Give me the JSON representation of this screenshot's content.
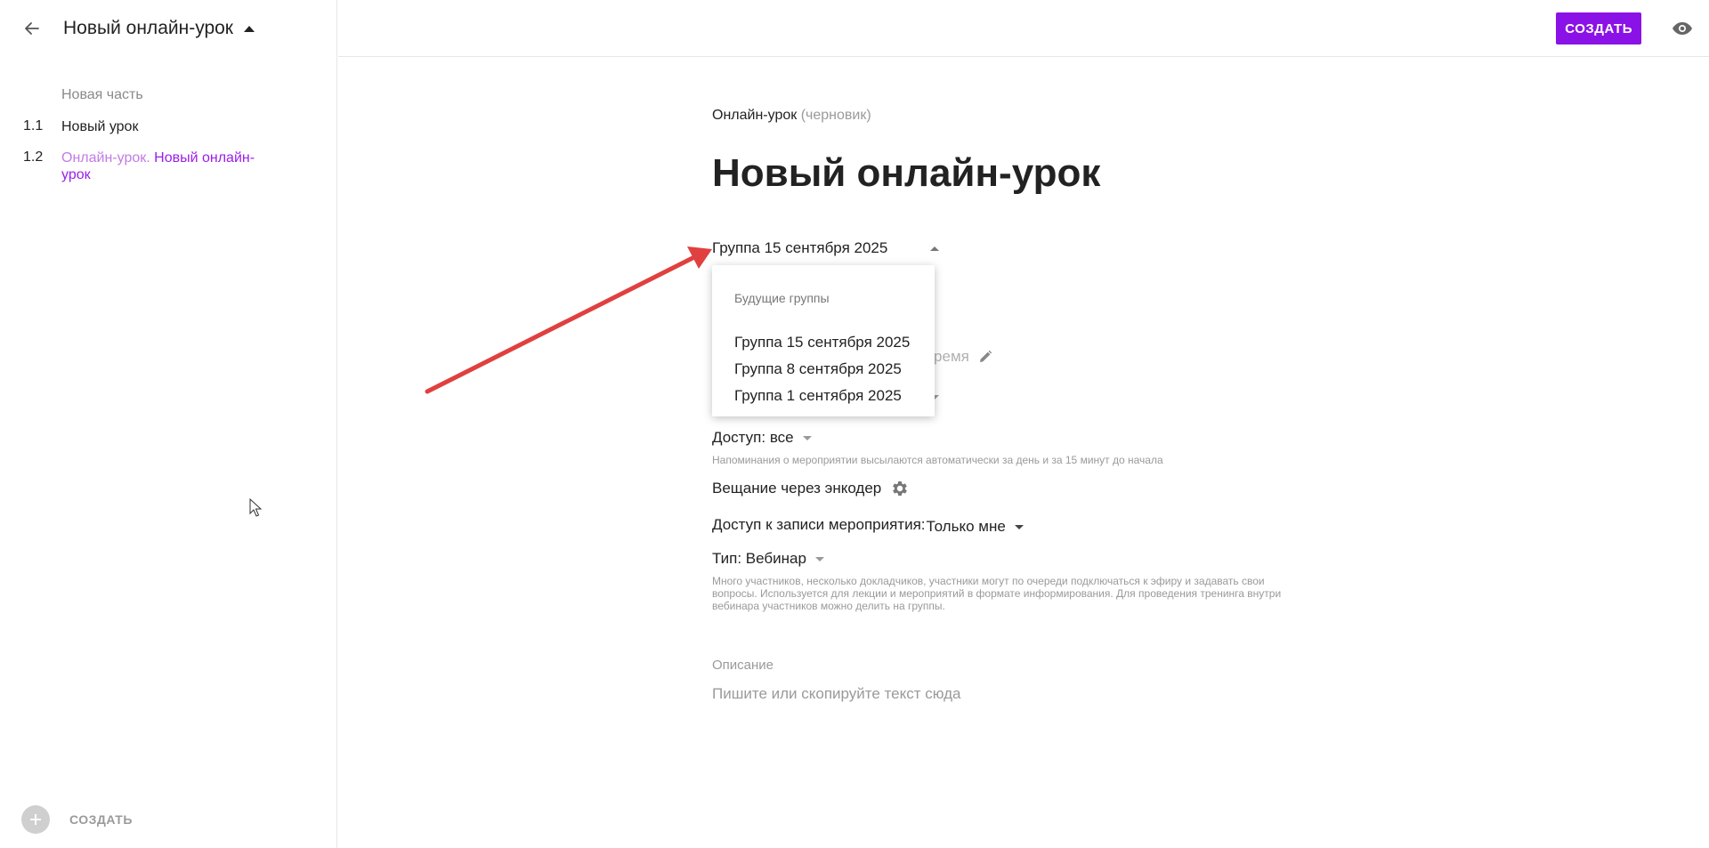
{
  "sidebar": {
    "course_title": "Новый онлайн-урок",
    "section_label": "Новая часть",
    "lessons": [
      {
        "num": "1.1",
        "title": "Новый урок"
      },
      {
        "num": "1.2",
        "prefix": "Онлайн-урок.",
        "name": "Новый онлайн-урок"
      }
    ],
    "create_label": "СОЗДАТЬ"
  },
  "topbar": {
    "create_label": "СОЗДАТЬ"
  },
  "main": {
    "lesson_type": "Онлайн-урок",
    "lesson_status": "(черновик)",
    "title": "Новый онлайн-урок",
    "group_selected": "Группа 15 сентября 2025",
    "time_hint": "время",
    "access_label": "Доступ:",
    "access_value": "все",
    "reminder_text": "Напоминания о мероприятии высылаются автоматически за день и за 15 минут до начала",
    "encoder_label": "Вещание через энкодер",
    "record_access_label": "Доступ к записи мероприятия:",
    "record_access_value": "Только мне",
    "type_label": "Тип:",
    "type_value": "Вебинар",
    "type_description": "Много участников, несколько докладчиков, участники могут по очереди подключаться к эфиру и задавать свои вопросы. Используется для лекции и мероприятий в формате информирования. Для проведения тренинга внутри вебинара участников можно делить на группы.",
    "description_label": "Описание",
    "description_placeholder": "Пишите или скопируйте текст сюда"
  },
  "dropdown": {
    "header": "Будущие группы",
    "options": [
      "Группа 15 сентября 2025",
      "Группа 8 сентября 2025",
      "Группа 1 сентября 2025"
    ]
  },
  "colors": {
    "accent": "#8b12e6",
    "active_lesson": "#9b1ee8",
    "annotation_arrow": "#e0403f"
  },
  "icons": [
    "arrow-left-icon",
    "caret-up-icon",
    "plus-icon",
    "eye-icon",
    "pencil-icon",
    "gear-icon",
    "caret-down-icon",
    "mouse-cursor-icon"
  ]
}
